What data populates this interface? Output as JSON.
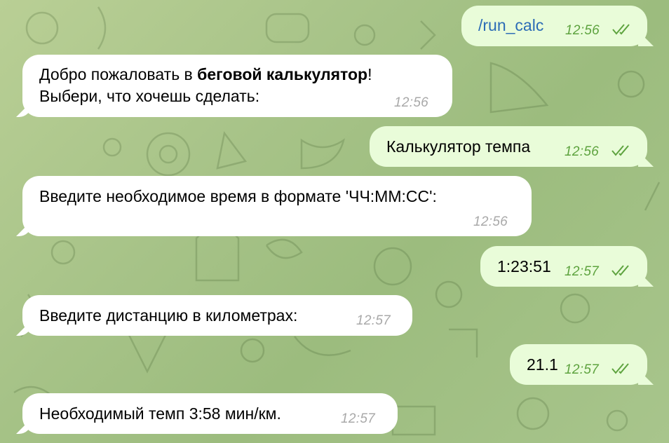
{
  "chat": {
    "messages": [
      {
        "direction": "out",
        "text": "/run_calc",
        "time": "12:56",
        "status": "read"
      },
      {
        "direction": "in",
        "text_line1_prefix": "Добро пожаловать в ",
        "text_line1_bold": "беговой калькулятор",
        "text_line1_suffix": "!",
        "text_line2": "Выбери, что хочешь сделать:",
        "time": "12:56"
      },
      {
        "direction": "out",
        "text": "Калькулятор темпа",
        "time": "12:56",
        "status": "read"
      },
      {
        "direction": "in",
        "text": "Введите необходимое время в формате 'ЧЧ:ММ:СС':",
        "time": "12:56"
      },
      {
        "direction": "out",
        "text": "1:23:51",
        "time": "12:57",
        "status": "read"
      },
      {
        "direction": "in",
        "text": "Введите дистанцию в километрах:",
        "time": "12:57"
      },
      {
        "direction": "out",
        "text": "21.1",
        "time": "12:57",
        "status": "read"
      },
      {
        "direction": "in",
        "text": "Необходимый темп 3:58 мин/км.",
        "time": "12:57"
      }
    ]
  },
  "colors": {
    "outgoing_bubble": "#e9fcd9",
    "incoming_bubble": "#ffffff",
    "read_ticks": "#5ea33f",
    "command_link": "#2c6cb6"
  },
  "icons": {
    "read_status": "double-check-icon"
  }
}
